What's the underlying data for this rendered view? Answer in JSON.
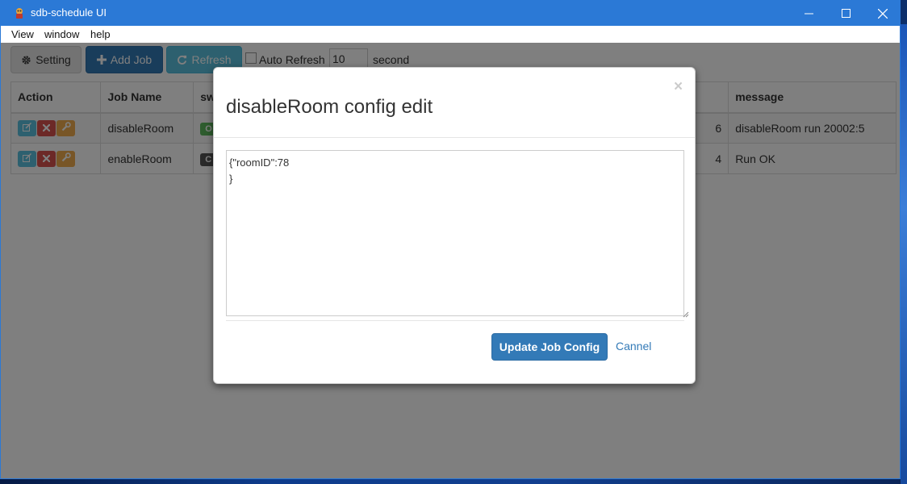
{
  "window": {
    "title": "sdb-schedule UI",
    "controls": {
      "minimize": "—",
      "maximize": "☐",
      "close": "✕"
    }
  },
  "menu": [
    "View",
    "window",
    "help"
  ],
  "toolbar": {
    "setting_label": "Setting",
    "add_job_label": "Add Job",
    "refresh_label": "Refresh",
    "auto_refresh_label": "Auto Refresh",
    "auto_refresh_value": "10",
    "auto_refresh_unit": "second"
  },
  "table": {
    "headers": [
      "Action",
      "Job Name",
      "sw",
      "message"
    ],
    "rows": [
      {
        "job_name": "disableRoom",
        "switch_badge": "O",
        "switch_color": "#5cb85c",
        "partial_value": "6",
        "message": "disableRoom run 20002:5"
      },
      {
        "job_name": "enableRoom",
        "switch_badge": "C",
        "switch_color": "#555555",
        "partial_value": "4",
        "message": "Run OK"
      }
    ]
  },
  "modal": {
    "title": "disableRoom config edit",
    "close_symbol": "×",
    "config_text": "{\"roomID\":78\n}",
    "update_label": "Update Job Config",
    "cancel_label": "Cannel"
  },
  "icons": [
    "app-icon",
    "gear-icon",
    "plus-icon",
    "refresh-icon",
    "edit-icon",
    "delete-icon",
    "wrench-icon"
  ]
}
